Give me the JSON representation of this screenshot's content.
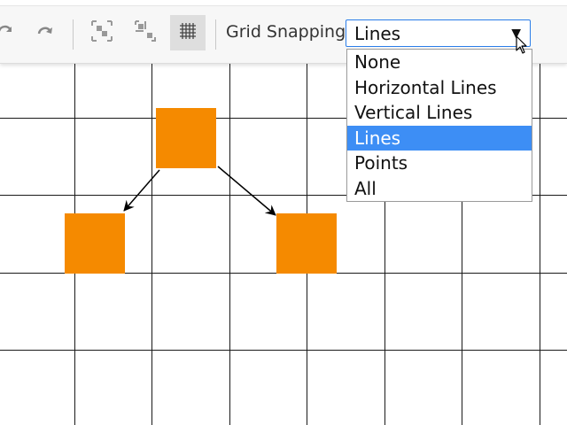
{
  "toolbar": {
    "buttons": [
      {
        "icon": "undo-icon"
      },
      {
        "icon": "redo-icon"
      },
      {
        "icon": "group-icon"
      },
      {
        "icon": "ungroup-icon"
      },
      {
        "icon": "grid-icon",
        "active": true
      }
    ],
    "snap_label": "Grid Snapping",
    "snap_select": {
      "value": "Lines",
      "arrow": "▼",
      "options": [
        "None",
        "Horizontal Lines",
        "Vertical Lines",
        "Lines",
        "Points",
        "All"
      ],
      "selected_index": 3
    }
  },
  "diagram": {
    "node_color": "#f58a00",
    "nodes": [
      {
        "id": "top"
      },
      {
        "id": "left"
      },
      {
        "id": "right"
      }
    ],
    "edges": [
      {
        "from": "top",
        "to": "left"
      },
      {
        "from": "top",
        "to": "right"
      }
    ]
  },
  "colors": {
    "accent": "#2b7de9",
    "selected_option": "#3d8ef5",
    "grid": "#1a1a1a"
  }
}
